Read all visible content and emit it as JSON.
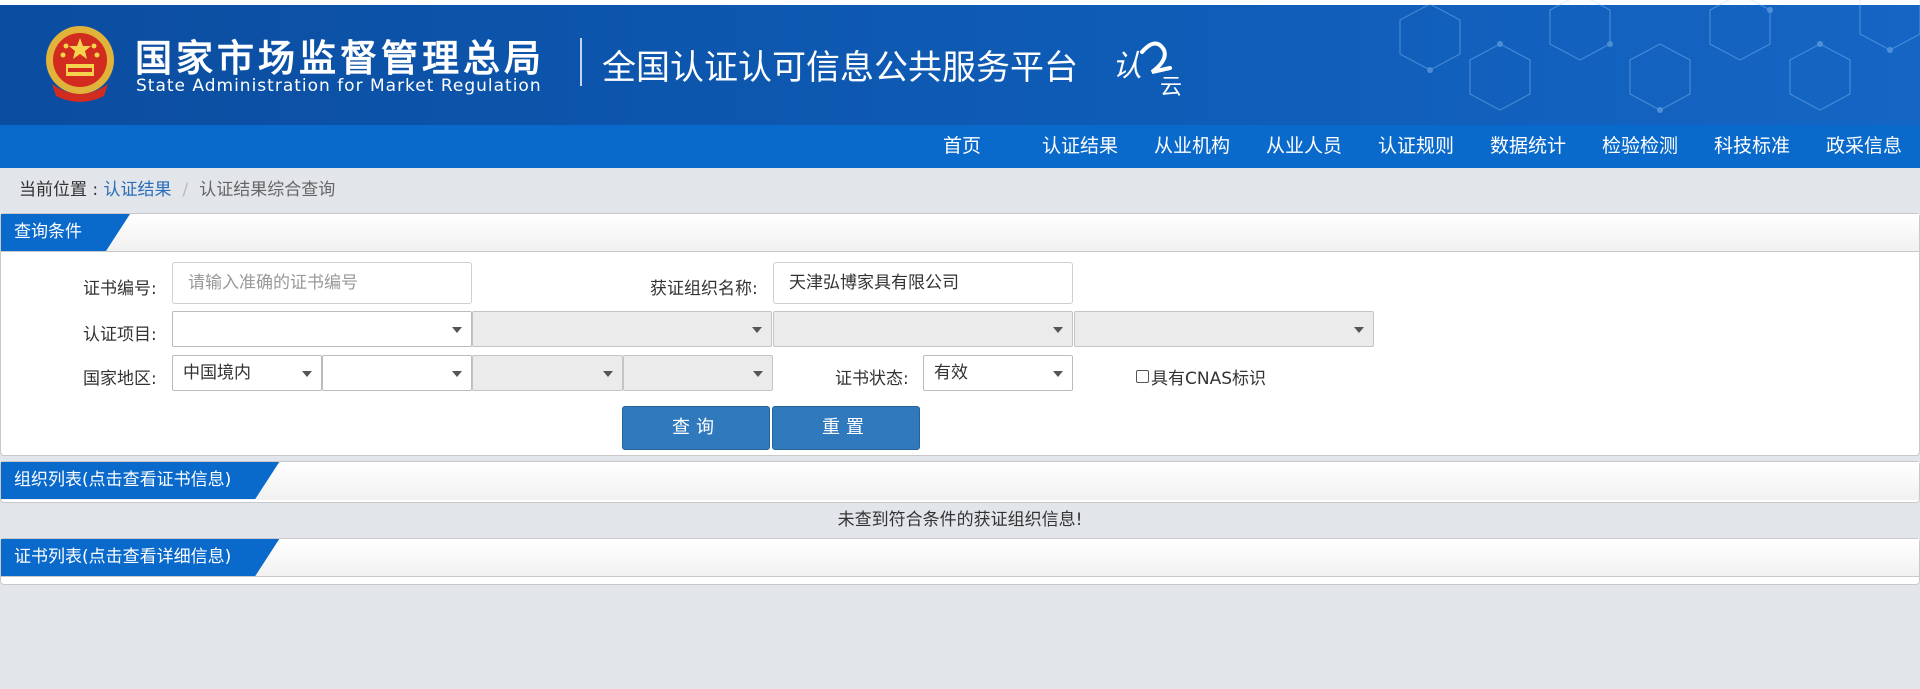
{
  "header": {
    "org_cn": "国家市场监督管理总局",
    "org_en": "State Administration  for  Market Regulation",
    "platform_title": "全国认证认可信息公共服务平台",
    "logo_text_1": "认",
    "logo_text_2": "云",
    "brand_color": "#0b4da0"
  },
  "nav": {
    "items": [
      "首页",
      "认证结果",
      "从业机构",
      "从业人员",
      "认证规则",
      "数据统计",
      "检验检测",
      "科技标准",
      "政采信息"
    ]
  },
  "breadcrumb": {
    "prefix": "当前位置 : ",
    "link": "认证结果",
    "separator": "/",
    "current": "认证结果综合查询"
  },
  "query": {
    "title": "查询条件",
    "cert_no_label": "证书编号:",
    "cert_no_placeholder": "请输入准确的证书编号",
    "org_name_label": "获证组织名称:",
    "org_name_value": "天津弘博家具有限公司",
    "project_label": "认证项目:",
    "region_label": "国家地区:",
    "region_value": "中国境内",
    "status_label": "证书状态:",
    "status_value": "有效",
    "cnas_label": "具有CNAS标识",
    "cnas_checked": false,
    "search_button": "查询",
    "reset_button": "重置"
  },
  "org_list": {
    "title": "组织列表(点击查看证书信息)",
    "empty_message": "未查到符合条件的获证组织信息!"
  },
  "cert_list": {
    "title": "证书列表(点击查看详细信息)"
  }
}
